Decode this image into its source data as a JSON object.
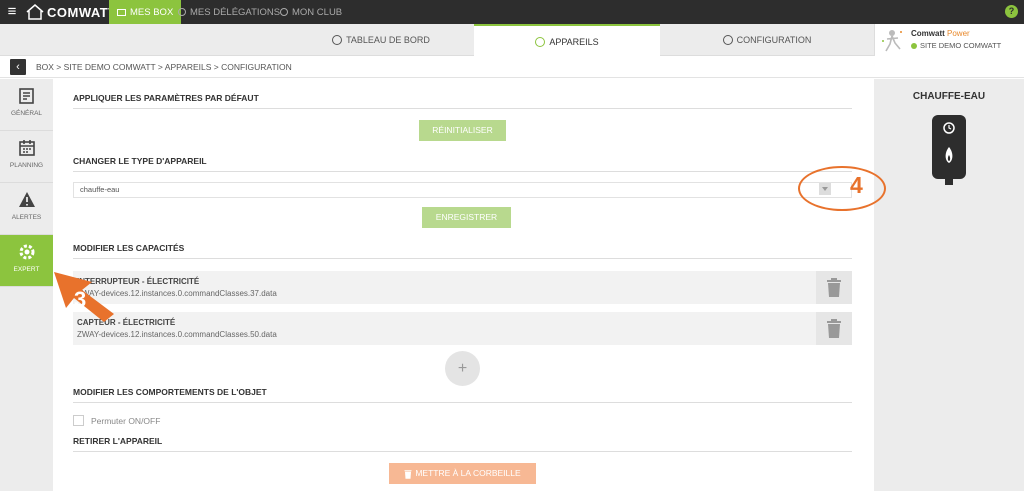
{
  "topbar": {
    "logo_text": "COMWATT",
    "nav": [
      {
        "label": "MES BOX",
        "active": true
      },
      {
        "label": "MES DÉLÉGATIONS",
        "active": false
      },
      {
        "label": "MON CLUB",
        "active": false
      }
    ],
    "help": "?"
  },
  "tabs": [
    {
      "label": "TABLEAU DE BORD",
      "icon": "dashboard-icon"
    },
    {
      "label": "APPAREILS",
      "icon": "plug-icon",
      "active": true
    },
    {
      "label": "CONFIGURATION",
      "icon": "gear-icon"
    }
  ],
  "account": {
    "brand": "Comwatt",
    "brand_suffix": "Power",
    "site": "SITE DEMO COMWATT"
  },
  "breadcrumb": "BOX > SITE DEMO COMWATT > APPAREILS > CONFIGURATION",
  "sidebar": [
    {
      "label": "GÉNÉRAL",
      "icon": "form-icon"
    },
    {
      "label": "PLANNING",
      "icon": "calendar-icon"
    },
    {
      "label": "ALERTES",
      "icon": "warning-icon"
    },
    {
      "label": "EXPERT",
      "icon": "expert-gear-icon",
      "active": true
    }
  ],
  "main": {
    "defaults": {
      "title": "APPLIQUER LES PARAMÈTRES PAR DÉFAUT",
      "button": "RÉINITIALISER"
    },
    "type": {
      "title": "CHANGER LE TYPE D'APPAREIL",
      "selected": "chauffe-eau",
      "button": "ENREGISTRER"
    },
    "capacities": {
      "title": "MODIFIER LES CAPACITÉS",
      "items": [
        {
          "title": "INTERRUPTEUR - ÉLECTRICITÉ",
          "path": "ZWAY-devices.12.instances.0.commandClasses.37.data"
        },
        {
          "title": "CAPTEUR - ÉLECTRICITÉ",
          "path": "ZWAY-devices.12.instances.0.commandClasses.50.data"
        }
      ],
      "add": "+"
    },
    "behaviours": {
      "title": "MODIFIER LES COMPORTEMENTS DE L'OBJET",
      "toggle_label": "Permuter ON/OFF"
    },
    "remove": {
      "title": "RETIRER L'APPAREIL",
      "button": "METTRE À LA CORBEILLE"
    }
  },
  "rightpanel": {
    "title": "CHAUFFE-EAU",
    "icon": "water-heater-icon"
  },
  "annotations": {
    "step3": "3",
    "step4": "4",
    "color": "#e8722c"
  },
  "colors": {
    "accent": "#8cc43e",
    "danger": "#f7b894",
    "dark": "#2d2d2d"
  }
}
